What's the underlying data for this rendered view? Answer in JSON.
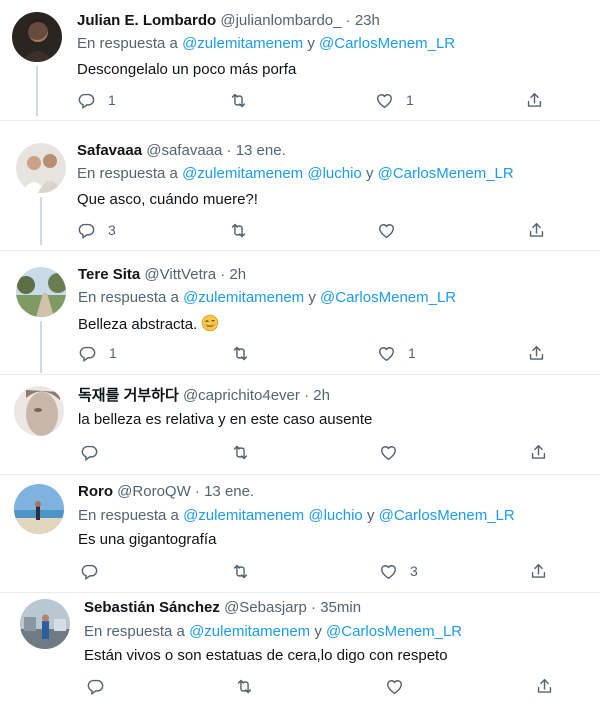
{
  "common": {
    "reply_prefix": "En respuesta a",
    "and_word": "y",
    "dot": "·"
  },
  "icons": {
    "reply": "reply-icon",
    "retweet": "retweet-icon",
    "like": "heart-icon",
    "share": "share-icon"
  },
  "colors": {
    "mention": "#1d9bf0",
    "secondary_text": "#536471",
    "thread_line": "#cfd9de"
  },
  "tweets": [
    {
      "name": "Julian E. Lombardo",
      "handle": "@julianlombardo_",
      "time": "23h",
      "mentions": [
        "@zulemitamenem",
        "@CarlosMenem_LR"
      ],
      "text": "Descongelalo un poco más porfa",
      "emoji": "",
      "replies": "1",
      "retweets": "",
      "likes": "1"
    },
    {
      "name": "Safavaaa",
      "handle": "@safavaaa",
      "time": "13 ene.",
      "mentions": [
        "@zulemitamenem",
        "@luchio",
        "@CarlosMenem_LR"
      ],
      "text": "Que asco, cuándo muere?!",
      "emoji": "",
      "replies": "3",
      "retweets": "",
      "likes": ""
    },
    {
      "name": "Tere Sita",
      "handle": "@VittVetra",
      "time": "2h",
      "mentions": [
        "@zulemitamenem",
        "@CarlosMenem_LR"
      ],
      "text": "Belleza abstracta.",
      "emoji": "woozy-face-emoji",
      "replies": "1",
      "retweets": "",
      "likes": "1"
    },
    {
      "name": "독재를 거부하다",
      "handle": "@caprichito4ever",
      "time": "2h",
      "mentions": [],
      "text": "la belleza es relativa y en este caso ausente",
      "emoji": "",
      "replies": "",
      "retweets": "",
      "likes": ""
    },
    {
      "name": "Roro",
      "handle": "@RoroQW",
      "time": "13 ene.",
      "mentions": [
        "@zulemitamenem",
        "@luchio",
        "@CarlosMenem_LR"
      ],
      "text": "Es una gigantografía",
      "emoji": "",
      "replies": "",
      "retweets": "",
      "likes": "3"
    },
    {
      "name": "Sebastián Sánchez",
      "handle": "@Sebasjarp",
      "time": "35min",
      "mentions": [
        "@zulemitamenem",
        "@CarlosMenem_LR"
      ],
      "text": "Están vivos o son estatuas de cera,lo digo con respeto",
      "emoji": "",
      "replies": "",
      "retweets": "",
      "likes": ""
    }
  ]
}
